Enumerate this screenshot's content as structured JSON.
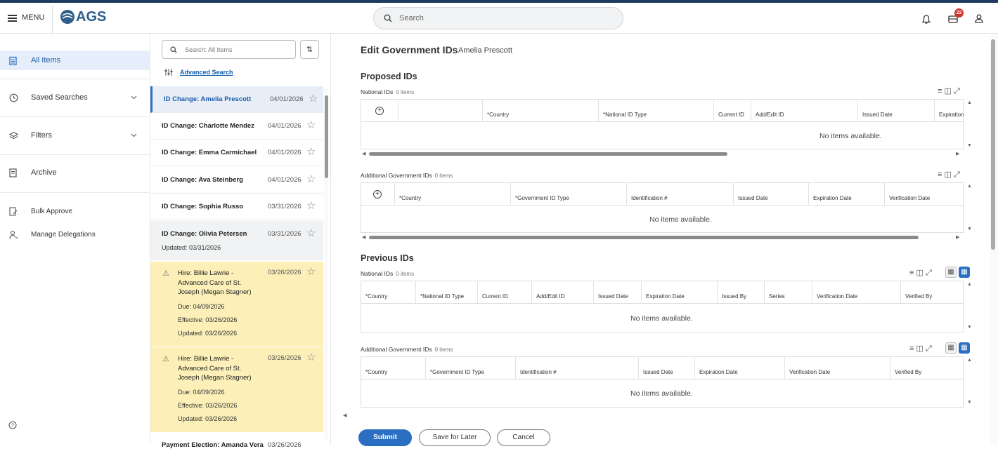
{
  "topbar": {
    "menu_label": "MENU",
    "logo_text": "AGS",
    "search_placeholder": "Search",
    "notification_count": "22"
  },
  "nav": {
    "all_items": "All Items",
    "saved_searches": "Saved Searches",
    "filters": "Filters",
    "archive": "Archive",
    "bulk_approve": "Bulk Approve",
    "manage_delegations": "Manage Delegations"
  },
  "list": {
    "search_placeholder": "Search: All Items",
    "advanced_search": "Advanced Search",
    "items": [
      {
        "title": "ID Change: Amelia Prescott",
        "date": "04/01/2026"
      },
      {
        "title": "ID Change: Charlotte Mendez",
        "date": "04/01/2026"
      },
      {
        "title": "ID Change: Emma Carmichael",
        "date": "04/01/2026"
      },
      {
        "title": "ID Change: Ava Steinberg",
        "date": "04/01/2026"
      },
      {
        "title": "ID Change: Sophia Russo",
        "date": "03/31/2026"
      },
      {
        "title": "ID Change: Olivia Petersen",
        "date": "03/31/2026",
        "updated": "Updated: 03/31/2026"
      }
    ],
    "cards": [
      {
        "title": "Hire: Billie Lawrie - Advanced Care of St. Joseph (Megan Stagner)",
        "date": "03/26/2026",
        "due": "Due: 04/09/2026",
        "effective": "Effective: 03/26/2026",
        "updated": "Updated: 03/26/2026"
      },
      {
        "title": "Hire: Billie Lawrie - Advanced Care of St. Joseph (Megan Stagner)",
        "date": "03/26/2026",
        "due": "Due: 04/09/2026",
        "effective": "Effective: 03/26/2026",
        "updated": "Updated: 03/26/2026"
      }
    ],
    "last_item": {
      "title": "Payment Election: Amanda Vera",
      "date": "03/26/2026"
    }
  },
  "main": {
    "title": "Edit Government IDs",
    "subtitle": "Amelia Prescott",
    "proposed_heading": "Proposed IDs",
    "previous_heading": "Previous IDs",
    "empty_text": "No items available.",
    "count_text": "0 items",
    "proposed_national": {
      "label": "National IDs",
      "columns": [
        "*Country",
        "*National ID Type",
        "Current ID",
        "Add/Edit ID",
        "Issued Date",
        "Expiration"
      ]
    },
    "proposed_additional": {
      "label": "Additional Government IDs",
      "columns": [
        "*Country",
        "*Government ID Type",
        "Identification #",
        "Issued Date",
        "Expiration Date",
        "Verification Date"
      ]
    },
    "previous_national": {
      "label": "National IDs",
      "columns": [
        "*Country",
        "*National ID Type",
        "Current ID",
        "Add/Edit ID",
        "Issued Date",
        "Expiration Date",
        "Issued By",
        "Series",
        "Verification Date",
        "Verified By"
      ]
    },
    "previous_additional": {
      "label": "Additional Government IDs",
      "columns": [
        "*Country",
        "*Government ID Type",
        "Identification #",
        "Issued Date",
        "Expiration Date",
        "Verification Date",
        "Verified By"
      ]
    }
  },
  "footer": {
    "submit": "Submit",
    "save_for_later": "Save for Later",
    "cancel": "Cancel"
  },
  "colors": {
    "primary": "#2b6fc2",
    "highlight_card": "#fcefb8",
    "selected_row": "#e7eef8",
    "badge": "#d0342c"
  }
}
